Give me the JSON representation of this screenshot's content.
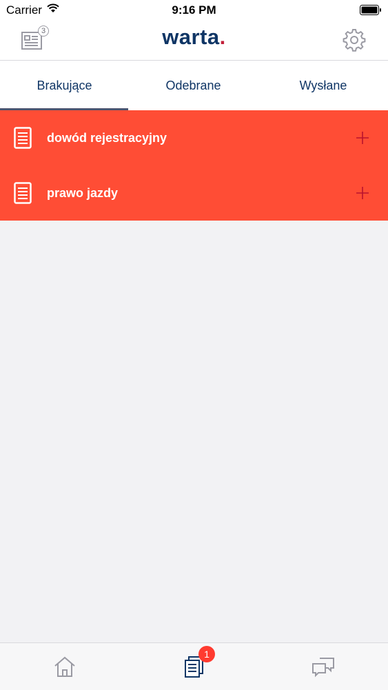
{
  "status_bar": {
    "carrier": "Carrier",
    "time": "9:16 PM"
  },
  "header": {
    "logo_text": "warta",
    "logo_dot": ".",
    "left_button_badge": "3",
    "icons": {
      "left": "policy-cards-icon",
      "right": "gear-icon"
    }
  },
  "tabs": [
    {
      "label": "Brakujące",
      "selected": true
    },
    {
      "label": "Odebrane",
      "selected": false
    },
    {
      "label": "Wysłane",
      "selected": false
    }
  ],
  "documents": [
    {
      "label": "dowód rejestracyjny",
      "icon": "document-icon",
      "action_icon": "plus-icon"
    },
    {
      "label": "prawo jazdy",
      "icon": "document-icon",
      "action_icon": "plus-icon"
    }
  ],
  "tab_bar": {
    "items": [
      {
        "icon": "home-icon"
      },
      {
        "icon": "documents-icon",
        "badge": "1"
      },
      {
        "icon": "chat-icon"
      }
    ]
  },
  "colors": {
    "brand_navy": "#0f3565",
    "brand_accent": "#c21f3a",
    "missing_row": "#ff4d35",
    "badge_red": "#ff3b30"
  }
}
